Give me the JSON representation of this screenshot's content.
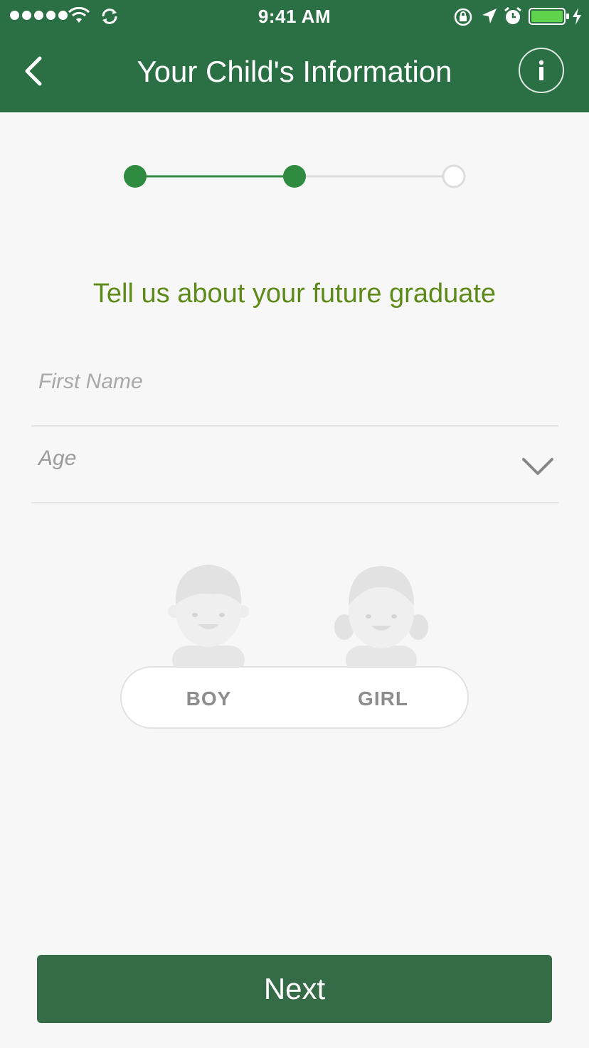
{
  "status_bar": {
    "time": "9:41 AM",
    "icons": [
      "signal-dots-icon",
      "wifi-icon",
      "sync-icon",
      "rotation-lock-icon",
      "location-icon",
      "alarm-icon",
      "battery-icon",
      "charging-icon"
    ]
  },
  "app_bar": {
    "title": "Your Child's Information",
    "back_icon": "chevron-left-icon",
    "info_icon": "info-icon"
  },
  "stepper": {
    "current_step": 2,
    "total_steps": 3,
    "active_color": "#2e8b40",
    "inactive_color": "#dcdcdc"
  },
  "form": {
    "heading": "Tell us about your future graduate",
    "first_name": {
      "placeholder": "First Name",
      "value": ""
    },
    "age": {
      "placeholder": "Age",
      "selected": ""
    }
  },
  "gender": {
    "boy_label": "BOY",
    "girl_label": "GIRL",
    "selected": ""
  },
  "actions": {
    "next_label": "Next"
  },
  "colors": {
    "brand_green": "#2b6f45",
    "heading_green": "#5d8a18",
    "button_green": "#366b48"
  }
}
